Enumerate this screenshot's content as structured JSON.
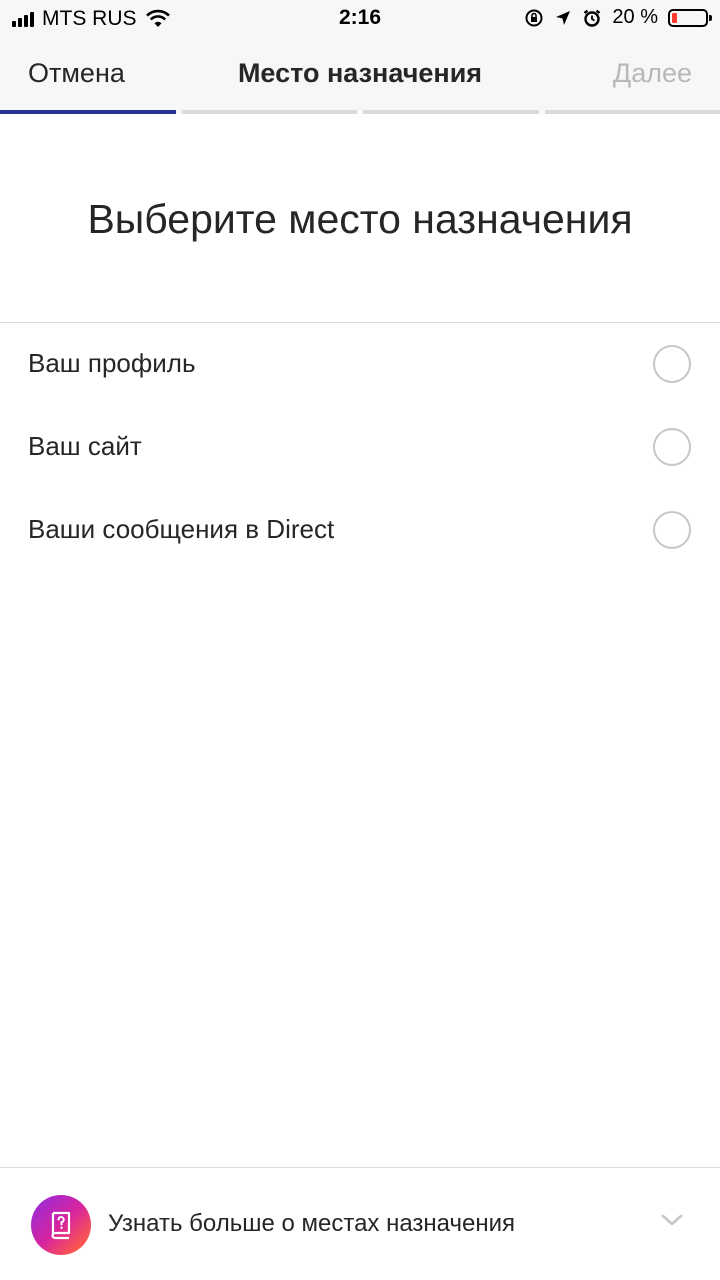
{
  "status_bar": {
    "carrier": "MTS RUS",
    "time": "2:16",
    "battery_percent": "20 %",
    "battery_level": 0.2
  },
  "nav": {
    "cancel_label": "Отмена",
    "title": "Место назначения",
    "next_label": "Далее",
    "progress_steps": 4,
    "progress_current": 1,
    "accent_color": "#283593"
  },
  "heading": "Выберите место назначения",
  "options": [
    {
      "label": "Ваш профиль",
      "selected": false
    },
    {
      "label": "Ваш сайт",
      "selected": false
    },
    {
      "label": "Ваши сообщения в Direct",
      "selected": false
    }
  ],
  "footer": {
    "learn_more_label": "Узнать больше о местах назначения",
    "icon": "book-question-icon",
    "chevron_icon": "chevron-down-icon"
  }
}
